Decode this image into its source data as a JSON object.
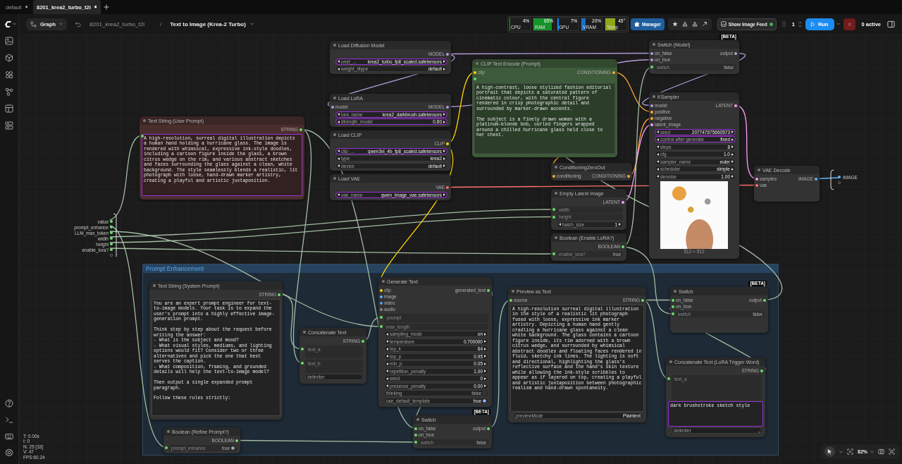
{
  "tabs": [
    {
      "label": "default",
      "selected": false,
      "unsaved": true
    },
    {
      "label": "8201_krea2_turbo_t2i",
      "selected": true,
      "unsaved": true
    }
  ],
  "toolbar": {
    "graph_menu": "Graph",
    "breadcrumb": [
      "8201_krea2_turbo_t2i",
      "Text to Image (Krea-2 Turbo)"
    ],
    "breadcrumb_separator": "/",
    "monitors": [
      {
        "label": "CPU",
        "value": "4%",
        "level": 0.04,
        "color": "#0aa015"
      },
      {
        "label": "RAM",
        "value": "85%",
        "level": 0.85,
        "color": "#17922a"
      },
      {
        "label": "GPU",
        "value": "7%",
        "level": 0.07,
        "color": "#0c86f4"
      },
      {
        "label": "VRAM",
        "value": "20%",
        "level": 0.2,
        "color": "#176ec7"
      },
      {
        "label": "Temp",
        "value": "45°",
        "level": 0.45,
        "color": "#8fa51a"
      }
    ],
    "manager_button": "Manager",
    "image_feed_button": "Show Image Feed",
    "queue_count": "1",
    "run_button": "Run",
    "active_jobs": "0 active"
  },
  "subgraph": {
    "inputs": [
      "value",
      "prompt_enhance",
      "LLM_max_token",
      "width",
      "height",
      "enable_lora?"
    ],
    "outputs": [
      "IMAGE"
    ]
  },
  "nodes": [
    {
      "title": "Load Diffusion Model",
      "color": "#333333",
      "outputs": [
        {
          "label": "MODEL",
          "color": "#b39ddb"
        }
      ],
      "widgets": [
        {
          "kind": "combo",
          "label": "unet_...",
          "value": "krea2_turbo_fp8_scaled.safetensors",
          "promoted": true
        },
        {
          "kind": "combo",
          "label": "weight_dtype",
          "value": "default",
          "promoted": false
        }
      ]
    },
    {
      "title": "Switch (Model)",
      "color": "#333333",
      "badge": "[BETA]",
      "inputs": [
        {
          "label": "on_false",
          "color": "#b39ddb"
        },
        {
          "label": "on_true",
          "color": "#b39ddb"
        }
      ],
      "outputs": [
        {
          "label": "output",
          "color": "#b39ddb"
        }
      ],
      "widgets": [
        {
          "kind": "linked",
          "label": "switch",
          "value": "false",
          "color": "#6bde6b",
          "promoted": false
        }
      ]
    },
    {
      "title": "CLIP Text Encode (Prompt)",
      "color": "#3d5a3a",
      "inputs": [
        {
          "label": "clip",
          "color": "#ffd500"
        },
        {
          "color": "#6bde6b"
        }
      ],
      "outputs": [
        {
          "label": "CONDITIONING",
          "color": "#ffa931"
        }
      ],
      "widgets": [
        {
          "kind": "text",
          "promoted": false,
          "value": "A high-contrast, loose stylized fashion editorial portrait that depicts a saturated pattern of cinematic colour, with the central figure rendered in crisp photographic detail and surrounded by marker-drawn accents.\n\nThe subject is a finely drawn woman with a platinum-blonde bob, curled fingers wrapped around a chilled hurricane glass held close to her chest."
        }
      ]
    },
    {
      "title": "Load LoRA",
      "color": "#333333",
      "inputs": [
        {
          "label": "model",
          "color": "#b39ddb"
        }
      ],
      "outputs": [
        {
          "label": "MODEL",
          "color": "#b39ddb"
        }
      ],
      "widgets": [
        {
          "kind": "combo",
          "label": "lora_name",
          "value": "krea2_darkbrush.safetensors",
          "promoted": true
        },
        {
          "kind": "number",
          "label": "strength_model",
          "value": "0.80",
          "promoted": true
        }
      ]
    },
    {
      "title": "KSampler",
      "color": "#333333",
      "inputs": [
        {
          "label": "model",
          "color": "#b39ddb"
        },
        {
          "label": "positive",
          "color": "#ffa931"
        },
        {
          "label": "negative",
          "color": "#ffa931"
        },
        {
          "label": "latent_image",
          "color": "#ff9cf9"
        }
      ],
      "outputs": [
        {
          "label": "LATENT",
          "color": "#ff9cf9"
        }
      ],
      "widgets": [
        {
          "kind": "number",
          "label": "seed",
          "value": "207747675660573",
          "promoted": true
        },
        {
          "kind": "combo",
          "label": "control after generate",
          "value": "fixed",
          "promoted": true
        },
        {
          "kind": "number",
          "label": "steps",
          "value": "8",
          "promoted": false
        },
        {
          "kind": "number",
          "label": "cfg",
          "value": "1.0",
          "promoted": false
        },
        {
          "kind": "combo",
          "label": "sampler_name",
          "value": "euler",
          "promoted": false
        },
        {
          "kind": "combo",
          "label": "scheduler",
          "value": "simple",
          "promoted": false
        },
        {
          "kind": "number",
          "label": "denoise",
          "value": "1.00",
          "promoted": false
        }
      ],
      "preview": {
        "caption": "512 × 512"
      }
    },
    {
      "title": "Text String (User Prompt)",
      "color": "#4a2e2e",
      "outputs": [
        {
          "label": "STRING",
          "color": "#6bde6b"
        }
      ],
      "widgets": [
        {
          "kind": "text",
          "promoted": true,
          "color": "#6bde6b",
          "value": "A high-resolution, surreal digital illustration depicts a human hand holding a hurricane glass. The image is rendered with whimsical, expressive ink-style doodles, including a cartoon figure inside the glass, a brown citrus wedge on the rim, and various abstract sketches and faces surrounding the glass against a clean, white background. The style seamlessly blends a realistic, lit photograph with loose, hand-drawn marker artistry, creating a playful and artistic juxtaposition."
        }
      ]
    },
    {
      "title": "Load CLIP",
      "color": "#333333",
      "outputs": [
        {
          "label": "CLIP",
          "color": "#ffd500"
        }
      ],
      "widgets": [
        {
          "kind": "combo",
          "label": "clip_...",
          "value": "qwen3vl_4b_fp8_scaled.safetensors",
          "promoted": true
        },
        {
          "kind": "combo",
          "label": "type",
          "value": "krea2",
          "promoted": false
        },
        {
          "kind": "combo",
          "label": "device",
          "value": "default",
          "promoted": false
        }
      ]
    },
    {
      "title": "ConditioningZeroOut",
      "color": "#333333",
      "inputs": [
        {
          "label": "conditioning",
          "color": "#ffa931"
        }
      ],
      "outputs": [
        {
          "label": "CONDITIONING",
          "color": "#ffa931"
        }
      ]
    },
    {
      "title": "VAE Decode",
      "color": "#333333",
      "inputs": [
        {
          "label": "samples",
          "color": "#ff9cf9"
        },
        {
          "label": "vae",
          "color": "#ff6e6e"
        }
      ],
      "outputs": [
        {
          "label": "IMAGE",
          "color": "#64b5f6"
        }
      ]
    },
    {
      "title": "Load VAE",
      "color": "#333333",
      "outputs": [
        {
          "label": "VAE",
          "color": "#ff6e6e"
        }
      ],
      "widgets": [
        {
          "kind": "combo",
          "label": "vae_name",
          "value": "qwen_image_vae.safetensors",
          "promoted": true
        }
      ]
    },
    {
      "title": "Empty Latent Image",
      "color": "#333333",
      "outputs": [
        {
          "label": "LATENT",
          "color": "#ff9cf9"
        }
      ],
      "widgets": [
        {
          "kind": "linked",
          "label": "width",
          "color": "#6bde6b",
          "promoted": false
        },
        {
          "kind": "linked",
          "label": "height",
          "color": "#6bde6b",
          "promoted": false
        },
        {
          "kind": "number",
          "label": "batch_size",
          "value": "1",
          "promoted": false
        }
      ]
    },
    {
      "title": "Boolean (Enable LoRA?)",
      "color": "#333333",
      "outputs": [
        {
          "label": "BOOLEAN",
          "color": "#6bde6b"
        }
      ],
      "widgets": [
        {
          "kind": "linked",
          "label": "enable_lora?",
          "value": "true",
          "color": "#6bde6b",
          "promoted": false
        }
      ]
    }
  ],
  "group": {
    "title": "Prompt Enhancement",
    "nodes": [
      {
        "title": "Text String (System Prompt)",
        "color": "#333333",
        "outputs": [
          {
            "label": "STRING",
            "color": "#6bde6b"
          }
        ],
        "widgets": [
          {
            "kind": "text",
            "promoted": false,
            "value": "You are an expert prompt engineer for text-to-image models. Your task is to expand the user's prompt into a highly effective image-generation prompt.\n\nThink step by step about the request before writing the answer:\n- What is the subject and mood?\n- What visual styles, mediums, and lighting options would fit? Consider two or three alternatives and pick the one that best serves the caption.\n- What composition, framing, and grounded details will help the text-to-image model?\n\nThen output a single expanded prompt paragraph.\n\nFollow these rules strictly:"
          }
        ]
      },
      {
        "title": "Generate Text",
        "color": "#333333",
        "inputs": [
          {
            "label": "clip",
            "color": "#ffd500"
          },
          {
            "label": "image",
            "color": "#64b5f6"
          },
          {
            "label": "video",
            "color": "#5c9ded"
          },
          {
            "label": "audio",
            "color": "#8a8a8a"
          }
        ],
        "outputs": [
          {
            "label": "generated_text",
            "color": "#6bde6b"
          }
        ],
        "widgets": [
          {
            "kind": "linked_text",
            "label": "prompt",
            "color": "#6bde6b",
            "promoted": false
          },
          {
            "kind": "linked",
            "label": "max_length",
            "color": "#6bde6b",
            "promoted": false
          },
          {
            "kind": "combo",
            "label": "sampling_mode",
            "value": "on",
            "promoted": false
          },
          {
            "kind": "number",
            "label": "temperature",
            "value": "0.700000",
            "promoted": false
          },
          {
            "kind": "number",
            "label": "top_k",
            "value": "64",
            "promoted": false
          },
          {
            "kind": "number",
            "label": "top_p",
            "value": "0.95",
            "promoted": false
          },
          {
            "kind": "number",
            "label": "min_p",
            "value": "0.05",
            "promoted": false
          },
          {
            "kind": "number",
            "label": "repetition_penalty",
            "value": "1.00",
            "promoted": false
          },
          {
            "kind": "number",
            "label": "seed",
            "value": "0",
            "promoted": false
          },
          {
            "kind": "number",
            "label": "presence_penalty",
            "value": "0.00",
            "promoted": false
          },
          {
            "kind": "toggle",
            "label": "thinking",
            "value": "false",
            "on": false,
            "promoted": false
          },
          {
            "kind": "toggle",
            "label": "use_default_template",
            "value": "true",
            "on": true,
            "promoted": false
          }
        ]
      },
      {
        "title": "Preview as Text",
        "color": "#333333",
        "inputs": [
          {
            "label": "source",
            "color": "#6bde6b"
          }
        ],
        "outputs": [
          {
            "label": "STRING",
            "color": "#6bde6b"
          }
        ],
        "widgets": [
          {
            "kind": "text",
            "promoted": false,
            "value": "A high-resolution surreal digital illustration in the style of a realistic lit photograph fused with loose, expressive ink marker artistry. Depicting a human hand gently cradling a hurricane glass against a clean white background. The glass contains a cartoon figure inside, its rim adorned with a brown citrus wedge, and surrounded by whimsical abstract doodles and floating faces rendered in fluid, sketchy ink lines. The lighting is soft and directional, highlighting the glass's reflective surface and the hand's skin texture while allowing the ink-style scribbles to appear as if layered on top, creating a playful and artistic juxtaposition between photographic realism and hand-drawn spontaneity."
          },
          {
            "kind": "field",
            "label": "previewMode",
            "value": "Plaintext",
            "promoted": false
          }
        ]
      },
      {
        "title": "Switch",
        "color": "#333333",
        "badge": "[BETA]",
        "inputs": [
          {
            "label": "on_false",
            "color": "#6bde6b"
          },
          {
            "label": "on_true",
            "color": "#6bde6b"
          }
        ],
        "outputs": [
          {
            "label": "output",
            "color": "#6bde6b"
          }
        ],
        "widgets": [
          {
            "kind": "linked",
            "label": "switch",
            "value": "false",
            "color": "#6bde6b",
            "promoted": false
          }
        ]
      },
      {
        "title": "Concatenate Text",
        "color": "#333333",
        "outputs": [
          {
            "label": "STRING",
            "color": "#6bde6b"
          }
        ],
        "widgets": [
          {
            "kind": "linked_text",
            "label": "text_a",
            "color": "#6bde6b",
            "promoted": false
          },
          {
            "kind": "linked_text",
            "label": "text_b",
            "color": "#6bde6b",
            "promoted": false
          },
          {
            "kind": "field",
            "label": "delimiter",
            "promoted": false
          }
        ]
      },
      {
        "title": "Concatenate Text (LoRA Trigger Word)",
        "color": "#333333",
        "outputs": [
          {
            "label": "STRING",
            "color": "#6bde6b"
          }
        ],
        "widgets": [
          {
            "kind": "linked_text",
            "label": "text_a",
            "color": "#6bde6b",
            "promoted": false
          },
          {
            "kind": "text",
            "promoted": true,
            "value": "dark brushstroke sketch style"
          },
          {
            "kind": "field",
            "label": "delimiter",
            "value": ",",
            "promoted": false
          }
        ]
      },
      {
        "title": "Switch",
        "color": "#333333",
        "badge": "[BETA]",
        "inputs": [
          {
            "label": "on_false",
            "color": "#6bde6b"
          },
          {
            "label": "on_true",
            "color": "#6bde6b"
          }
        ],
        "outputs": [
          {
            "label": "output",
            "color": "#6bde6b"
          }
        ],
        "widgets": [
          {
            "kind": "linked",
            "label": "switch",
            "value": "false",
            "color": "#6bde6b",
            "promoted": false
          }
        ]
      },
      {
        "title": "Boolean (Refine Prompt?)",
        "color": "#333333",
        "outputs": [
          {
            "label": "BOOLEAN",
            "color": "#6bde6b"
          }
        ],
        "widgets": [
          {
            "kind": "linked_toggle",
            "label": "prompt_enhance",
            "value": "true",
            "on": true,
            "color": "#6bde6b",
            "promoted": false
          }
        ]
      }
    ]
  },
  "canvas": {
    "stats": [
      "T: 0.00s",
      "I: 0",
      "N: 25 [33]",
      "V: 47",
      "FPS:60.24"
    ],
    "zoom": "82%"
  }
}
